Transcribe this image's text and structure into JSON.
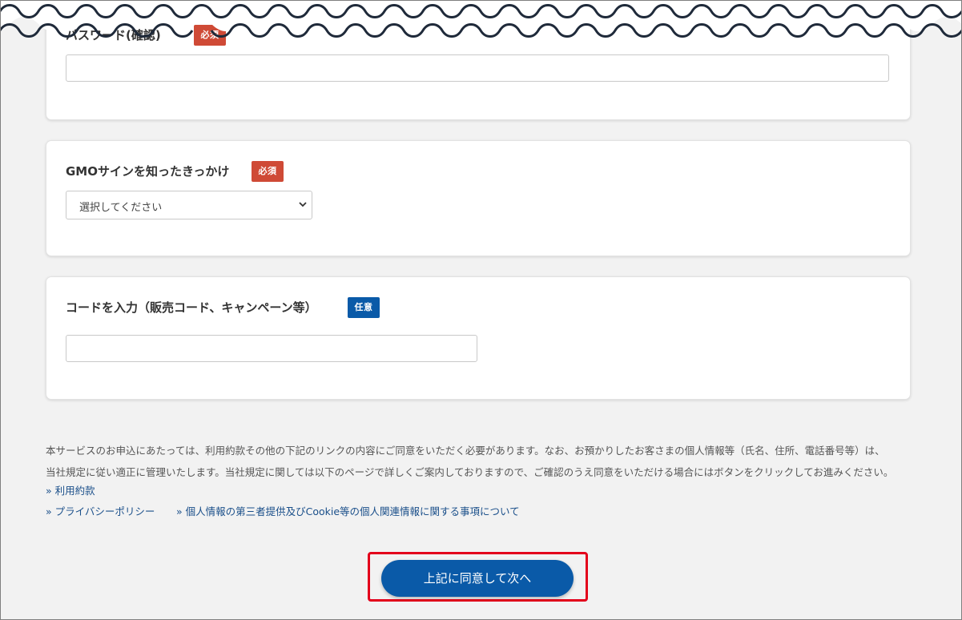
{
  "form": {
    "password_confirm": {
      "label": "パスワード(確認)",
      "badge": "必須"
    },
    "referral": {
      "label": "GMOサインを知ったきっかけ",
      "badge": "必須",
      "selected": "選択してください"
    },
    "code": {
      "label": "コードを入力（販売コード、キャンペーン等）",
      "badge": "任意"
    }
  },
  "notice": {
    "line1": "本サービスのお申込にあたっては、利用約款その他の下記のリンクの内容にご同意をいただく必要があります。なお、お預かりしたお客さまの個人情報等（氏名、住所、電話番号等）は、",
    "line2": "当社規定に従い適正に管理いたします。当社規定に関しては以下のページで詳しくご案内しておりますので、ご確認のうえ同意をいただける場合にはボタンをクリックしてお進みください。"
  },
  "links": {
    "terms": "» 利用約款",
    "privacy": "» プライバシーポリシー",
    "third_party": "» 個人情報の第三者提供及びCookie等の個人関連情報に関する事項について"
  },
  "submit_label": "上記に同意して次へ",
  "colors": {
    "required_badge": "#cf4a36",
    "optional_badge": "#0a5aa8",
    "primary_button": "#0a5aa8",
    "highlight_border": "#e3001b",
    "link": "#1a4f8a"
  }
}
